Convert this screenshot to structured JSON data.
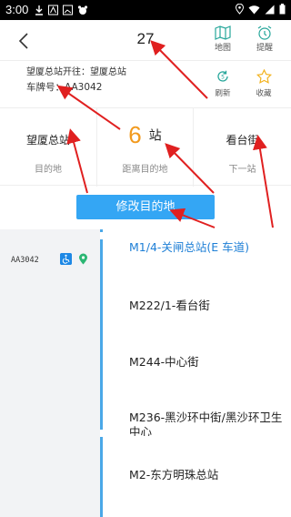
{
  "status_bar": {
    "time": "3:00"
  },
  "header": {
    "title": "27",
    "map_label": "地图",
    "remind_label": "提醒"
  },
  "info": {
    "direction": "望厦总站开往：望厦总站",
    "plate": "车牌号：AA3042",
    "refresh_label": "刷新",
    "fav_label": "收藏"
  },
  "summary": {
    "destination_name": "望厦总站",
    "destination_caption": "目的地",
    "stops_count": "6",
    "stops_unit": "站",
    "distance_caption": "距离目的地",
    "next_stop_name": "看台街",
    "next_stop_caption": "下一站"
  },
  "change_button_label": "修改目的地",
  "route": {
    "bus_id": "AA3042",
    "stops": [
      "M1/4-关闸总站(E 车道)",
      "M222/1-看台街",
      "M244-中心街",
      "M236-黑沙环中街/黑沙环卫生中心",
      "M2-东方明珠总站"
    ]
  },
  "colors": {
    "accent": "#34a6f4",
    "highlight_number": "#f29a1e",
    "current_stop": "#1e7fd6",
    "annotation": "#e02020"
  }
}
